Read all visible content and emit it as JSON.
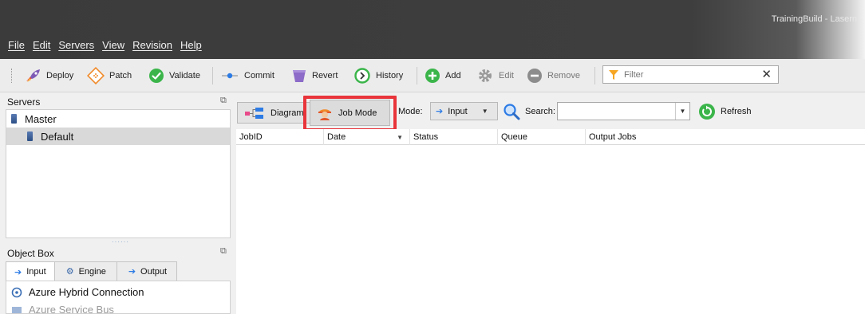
{
  "window": {
    "title": "TrainingBuild - Lasern"
  },
  "menu": [
    "File",
    "Edit",
    "Servers",
    "View",
    "Revision",
    "Help"
  ],
  "toolbar": {
    "deploy": "Deploy",
    "patch": "Patch",
    "validate": "Validate",
    "commit": "Commit",
    "revert": "Revert",
    "history": "History",
    "add": "Add",
    "edit": "Edit",
    "remove": "Remove",
    "filter_placeholder": "Filter"
  },
  "servers": {
    "title": "Servers",
    "items": [
      {
        "label": "Master"
      },
      {
        "label": "Default"
      }
    ]
  },
  "object_box": {
    "title": "Object Box",
    "tabs": [
      "Input",
      "Engine",
      "Output"
    ],
    "items": [
      "Azure Hybrid Connection",
      "Azure Service Bus"
    ]
  },
  "main": {
    "diagram": "Diagram",
    "job_mode": "Job Mode",
    "mode_label": "Mode:",
    "mode_value": "Input",
    "search_label": "Search:",
    "refresh": "Refresh",
    "columns": [
      "JobID",
      "Date",
      "Status",
      "Queue",
      "Output Jobs"
    ]
  },
  "colors": {
    "titlebar": "#3b3b3b",
    "highlight": "#e8343a",
    "accent_green": "#3bb54a",
    "accent_blue": "#2c7be5"
  }
}
